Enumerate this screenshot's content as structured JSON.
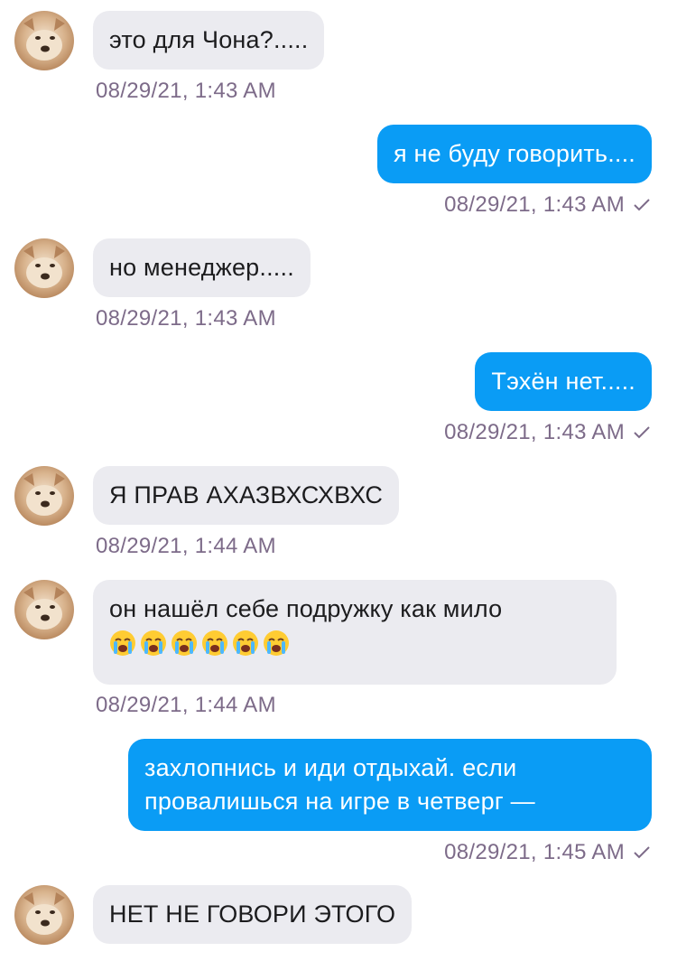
{
  "conversation": {
    "messages": [
      {
        "id": "m1",
        "direction": "incoming",
        "text": "это для Чона?.....",
        "time": "08/29/21, 1:43 AM"
      },
      {
        "id": "m2",
        "direction": "outgoing",
        "text": "я не буду говорить....",
        "time": "08/29/21, 1:43 AM",
        "status": "read-check-icon"
      },
      {
        "id": "m3",
        "direction": "incoming",
        "text": "но менеджер.....",
        "time": "08/29/21, 1:43 AM"
      },
      {
        "id": "m4",
        "direction": "outgoing",
        "text": "Тэхён нет.....",
        "time": "08/29/21, 1:43 AM",
        "status": "read-check-icon"
      },
      {
        "id": "m5",
        "direction": "incoming",
        "text": "Я ПРАВ АХАЗВХСХВХС",
        "time": "08/29/21, 1:44 AM"
      },
      {
        "id": "m6",
        "direction": "incoming",
        "text": "он нашёл себе подружку как мило",
        "emoji": [
          "loudly-crying-face-emoji",
          "loudly-crying-face-emoji",
          "loudly-crying-face-emoji",
          "loudly-crying-face-emoji",
          "loudly-crying-face-emoji",
          "loudly-crying-face-emoji"
        ],
        "time": "08/29/21, 1:44 AM"
      },
      {
        "id": "m7",
        "direction": "outgoing",
        "text": "захлопнись и иди отдыхай. если провалишься на игре в четверг —",
        "time": "08/29/21, 1:45 AM",
        "status": "read-check-icon"
      },
      {
        "id": "m8",
        "direction": "incoming",
        "text": "НЕТ НЕ ГОВОРИ ЭТОГО"
      }
    ]
  },
  "colors": {
    "incoming_bubble": "#ebebf0",
    "outgoing_bubble": "#0a9cf5",
    "timestamp": "#7d6b89"
  }
}
